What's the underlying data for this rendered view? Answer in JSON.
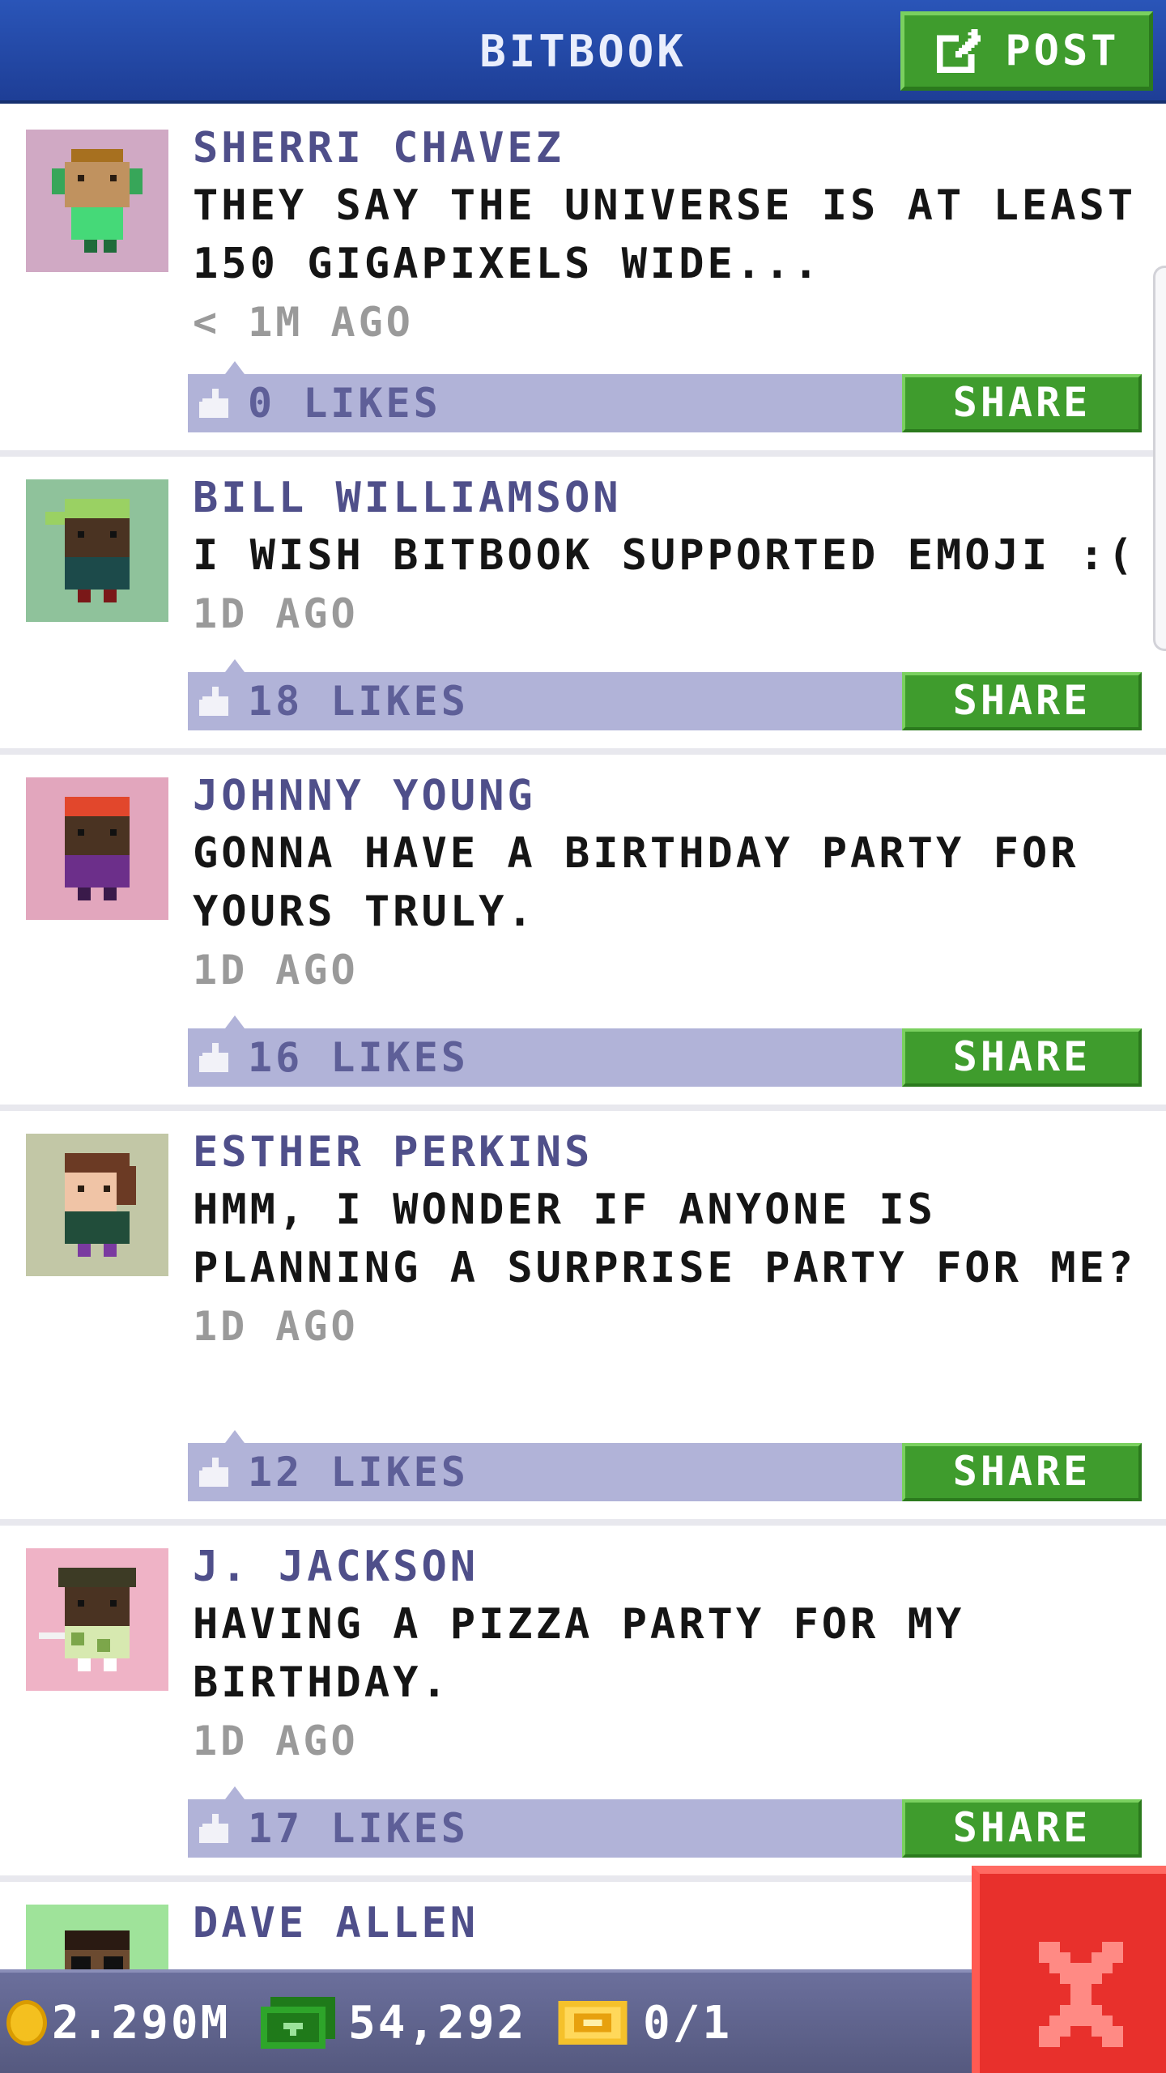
{
  "header": {
    "title": "BITBOOK",
    "post_label": "POST"
  },
  "posts": [
    {
      "author": "SHERRI CHAVEZ",
      "message": "THEY SAY THE UNIVERSE IS AT LEAST 150 GIGAPIXELS WIDE...",
      "time": "< 1M AGO",
      "likes": "0 LIKES",
      "share_label": "SHARE",
      "avatar_bg": "#d0a9c4"
    },
    {
      "author": "BILL WILLIAMSON",
      "message": "I WISH BITBOOK SUPPORTED EMOJI :(",
      "time": "1D AGO",
      "likes": "18 LIKES",
      "share_label": "SHARE",
      "avatar_bg": "#8fc29b"
    },
    {
      "author": "JOHNNY YOUNG",
      "message": "GONNA HAVE A BIRTHDAY PARTY FOR YOURS TRULY.",
      "time": "1D AGO",
      "likes": "16 LIKES",
      "share_label": "SHARE",
      "avatar_bg": "#e2a6bd"
    },
    {
      "author": "ESTHER PERKINS",
      "message": "HMM, I WONDER IF ANYONE IS PLANNING A SURPRISE PARTY FOR ME?",
      "time": "1D AGO",
      "likes": "12 LIKES",
      "share_label": "SHARE",
      "avatar_bg": "#c2c7a6"
    },
    {
      "author": "J. JACKSON",
      "message": "HAVING A PIZZA PARTY FOR MY BIRTHDAY.",
      "time": "1D AGO",
      "likes": "17 LIKES",
      "share_label": "SHARE",
      "avatar_bg": "#efb3c6"
    },
    {
      "author": "DAVE ALLEN",
      "avatar_bg": "#9fe39a"
    }
  ],
  "status": {
    "coins": "2.290M",
    "bux": "54,292",
    "tickets": "0/1"
  },
  "colors": {
    "header": "#2a55b8",
    "accent_green": "#3f9c2d",
    "like_bar": "#b1b3d8",
    "close_red": "#e8302c"
  },
  "icons": {
    "post": "edit-icon",
    "like": "thumbs-up-icon",
    "coin": "coin-icon",
    "bux": "bux-icon",
    "ticket": "ticket-icon",
    "close": "close-icon"
  }
}
